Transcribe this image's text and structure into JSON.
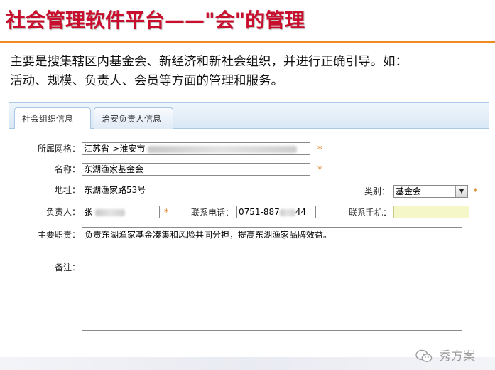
{
  "slide": {
    "title": "社会管理软件平台——\"会\"的管理",
    "intro_line1": "主要是搜集辖区内基金会、新经济和新社会组织，并进行正确引导。如：",
    "intro_line2": "活动、规模、负责人、会员等方面的管理和服务。"
  },
  "tabs": [
    {
      "label": "社会组织信息",
      "active": true
    },
    {
      "label": "治安负责人信息",
      "active": false
    }
  ],
  "form": {
    "grid_label": "所属网格：",
    "grid_value": "江苏省->淮安市",
    "name_label": "名称：",
    "name_value": "东湖渔家基金会",
    "address_label": "地址：",
    "address_value": "东湖渔家路53号",
    "category_label": "类别：",
    "category_value": "基金会",
    "leader_label": "负责人：",
    "leader_value": "张",
    "phone_label": "联系电话：",
    "phone_value": "0751-887",
    "phone_tail": "44",
    "mobile_label": "联系手机：",
    "mobile_value": "",
    "duty_label": "主要职责：",
    "duty_value": "负责东湖渔家基金凑集和风险共同分担，提高东湖渔家品牌效益。",
    "note_label": "备注：",
    "note_value": "",
    "required_mark": "*"
  },
  "watermark": {
    "text": "秀方案",
    "icon": "wechat-icon"
  },
  "colors": {
    "title": "#c8102e",
    "rule": "#f08a24",
    "required": "#e07b1a",
    "mobile_field": "#f6f7c8"
  }
}
